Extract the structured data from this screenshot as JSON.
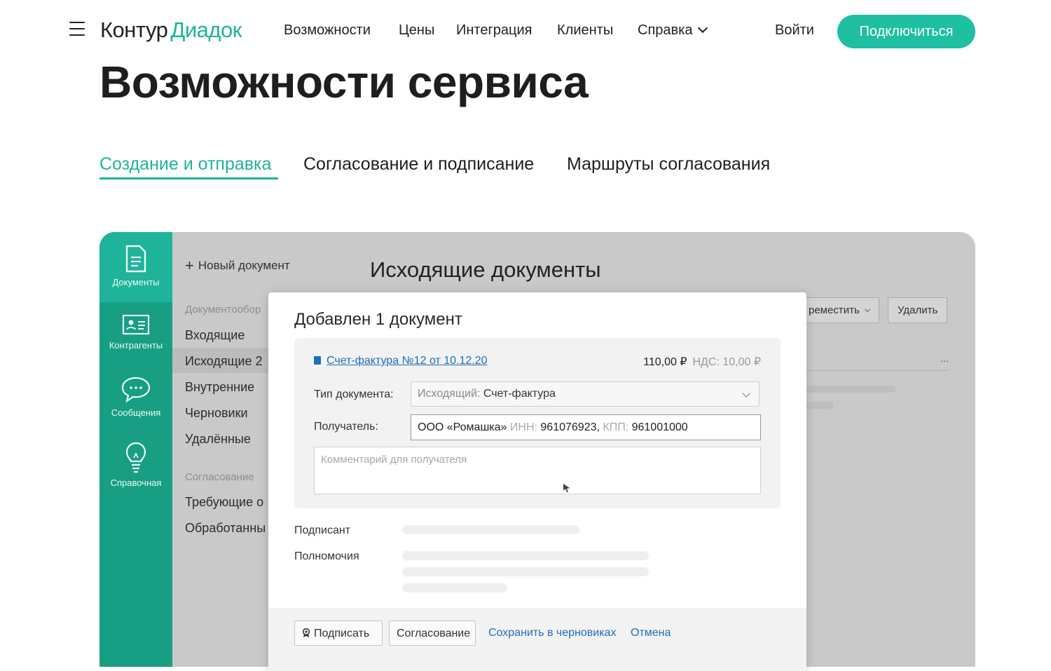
{
  "header": {
    "logo_left": "Контур",
    "logo_right": "Диадок",
    "nav": [
      "Возможности",
      "Цены",
      "Интеграция",
      "Клиенты",
      "Справка"
    ],
    "login": "Войти",
    "cta": "Подключиться"
  },
  "page": {
    "title": "Возможности сервиса",
    "tabs": [
      "Создание и отправка",
      "Согласование и подписание",
      "Маршруты согласования"
    ],
    "active_tab": "Создание и отправка"
  },
  "app": {
    "rail": [
      {
        "label": "Документы",
        "icon": "document-icon"
      },
      {
        "label": "Контрагенты",
        "icon": "contact-card-icon"
      },
      {
        "label": "Сообщения",
        "icon": "chat-bubble-icon"
      },
      {
        "label": "Справочная",
        "icon": "lightbulb-icon"
      }
    ],
    "new_document": "Новый документ",
    "section_docs": "Документообор",
    "folders": [
      "Входящие",
      "Исходящие 2",
      "Внутренние",
      "Черновики",
      "Удалённые"
    ],
    "section_approval": "Согласование",
    "approval_items": [
      "Требующие о",
      "Обработанны"
    ],
    "main_title": "Исходящие документы",
    "btn_move": "реместить",
    "btn_delete": "Удалить",
    "row_dots": "..."
  },
  "modal": {
    "title": "Добавлен 1 документ",
    "doc_link": "Счет-фактура №12 от 10.12.20",
    "amount": "110,00 ₽",
    "vat": "НДС: 10,00 ₽",
    "type_label": "Тип документа:",
    "type_prefix": "Исходящий:",
    "type_value": "Счет-фактура",
    "recipient_label": "Получатель:",
    "recipient_name": "ООО «Ромашка»",
    "inn_label": "ИНН:",
    "inn_value": "961076923,",
    "kpp_label": "КПП:",
    "kpp_value": "961001000",
    "comment_placeholder": "Комментарий для получателя",
    "signer_label": "Подписант",
    "authority_label": "Полномочия",
    "btn_sign": "Подписать",
    "btn_approval": "Согласование",
    "link_save": "Сохранить в черновиках",
    "link_cancel": "Отмена"
  },
  "colors": {
    "brand": "#1fb39a",
    "cta": "#1fbfa2",
    "rail": "#179e83",
    "link": "#1f6fb8"
  }
}
